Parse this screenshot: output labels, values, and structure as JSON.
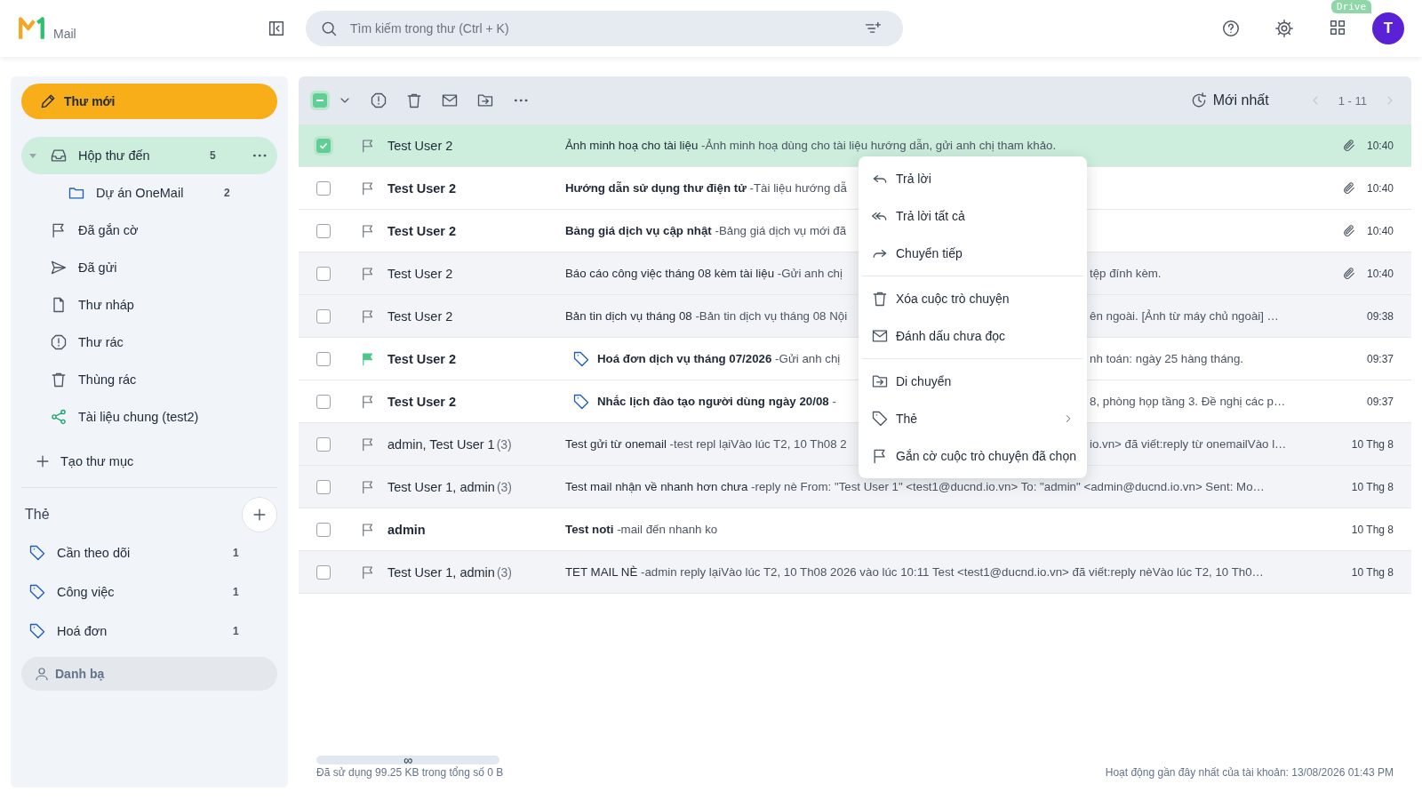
{
  "app": {
    "name": "Mail"
  },
  "search": {
    "placeholder": "Tìm kiếm trong thư (Ctrl + K)"
  },
  "apps_badge": "Drive",
  "avatar": "T",
  "compose": "Thư mới",
  "folders": [
    {
      "name": "Hộp thư đến",
      "count": "5",
      "selected": true,
      "expanded": true,
      "children": [
        {
          "name": "Dự án OneMail",
          "count": "2",
          "selected": false
        }
      ]
    },
    {
      "name": "Đã gắn cờ",
      "selected": false
    },
    {
      "name": "Đã gửi",
      "selected": false
    },
    {
      "name": "Thư nháp",
      "selected": false
    },
    {
      "name": "Thư rác",
      "selected": false
    },
    {
      "name": "Thùng rác",
      "selected": false
    },
    {
      "name": "Tài liệu chung (test2)",
      "selected": false
    }
  ],
  "new_folder": "Tạo thư mục",
  "tags_section": {
    "title": "Thẻ",
    "tags": [
      {
        "name": "Cần theo dõi",
        "count": "1"
      },
      {
        "name": "Công việc",
        "count": "1"
      },
      {
        "name": "Hoá đơn",
        "count": "1"
      }
    ]
  },
  "contacts": "Danh bạ",
  "toolbar": {
    "partial_selection": true,
    "sort": "Mới nhất",
    "range": "1 - 11",
    "prev_disabled": true,
    "next_disabled": true
  },
  "rows": [
    {
      "sender": "Test User 2",
      "subject": "Ảnh minh hoạ cho tài liệu",
      "preview": "-Ảnh minh hoạ dùng cho tài liệu hướng dẫn, gửi anh chị tham khảo.",
      "time": "10:40",
      "unread": false,
      "selected": true,
      "flagged": false,
      "tagged": false,
      "attachment": true
    },
    {
      "sender": "Test User 2",
      "subject": "Hướng dẫn sử dụng thư điện tử",
      "preview": "-Tài liệu hướng dẫ",
      "time": "10:40",
      "unread": true,
      "selected": false,
      "flagged": false,
      "tagged": false,
      "attachment": true
    },
    {
      "sender": "Test User 2",
      "subject": "Bảng giá dịch vụ cập nhật",
      "preview": "-Bảng giá dịch vụ mới đã",
      "time": "10:40",
      "unread": true,
      "selected": false,
      "flagged": false,
      "tagged": false,
      "attachment": true
    },
    {
      "sender": "Test User 2",
      "subject": "Báo cáo công việc tháng 08 kèm tài liệu",
      "preview": "-Gửi anh chị",
      "tail": "tệp đính kèm.",
      "time": "10:40",
      "unread": false,
      "selected": false,
      "flagged": false,
      "tagged": false,
      "attachment": true
    },
    {
      "sender": "Test User 2",
      "subject": "Bản tin dịch vụ tháng 08",
      "preview": "-Bản tin dịch vụ tháng 08 Nội",
      "tail": "ên ngoài. [Ảnh từ máy chủ ngoài] …",
      "time": "09:38",
      "unread": false,
      "selected": false,
      "flagged": false,
      "tagged": false,
      "attachment": false
    },
    {
      "sender": "Test User 2",
      "subject": "Hoá đơn dịch vụ tháng 07/2026",
      "preview": "-Gửi anh chị",
      "tail": "nh toán: ngày 25 hàng tháng.",
      "time": "09:37",
      "unread": true,
      "selected": false,
      "flagged": true,
      "tagged": true,
      "attachment": false
    },
    {
      "sender": "Test User 2",
      "subject": "Nhắc lịch đào tạo người dùng ngày 20/08",
      "preview": "-",
      "tail": "8, phòng họp tầng 3. Đề nghị các p…",
      "time": "09:37",
      "unread": true,
      "selected": false,
      "flagged": false,
      "tagged": true,
      "attachment": false
    },
    {
      "sender": "admin, Test User 1",
      "count": "(3)",
      "subject": "Test gửi từ onemail",
      "preview": "-test repl lạiVào lúc T2, 10 Th08 2",
      "tail": "io.vn> đã viết:reply từ onemailVào l…",
      "time": "10 Thg 8",
      "unread": false,
      "selected": false,
      "flagged": false,
      "tagged": false,
      "attachment": false
    },
    {
      "sender": "Test User 1, admin",
      "count": "(3)",
      "subject": "Test mail nhận về nhanh hơn chưa",
      "preview": "-reply nè From: \"Test User 1\" <test1@ducnd.io.vn> To: \"admin\" <admin@ducnd.io.vn> Sent: Mo…",
      "time": "10 Thg 8",
      "unread": false,
      "selected": false,
      "flagged": false,
      "tagged": false,
      "attachment": false
    },
    {
      "sender": "admin",
      "subject": "Test noti",
      "preview": "-mail đến nhanh ko",
      "time": "10 Thg 8",
      "unread": true,
      "selected": false,
      "flagged": false,
      "tagged": false,
      "attachment": false
    },
    {
      "sender": "Test User 1, admin",
      "count": "(3)",
      "subject": "TET MAIL NÈ",
      "preview": "-admin reply lạiVào lúc T2, 10 Th08 2026 vào lúc 10:11 Test <test1@ducnd.io.vn> đã viết:reply nèVào lúc T2, 10 Th0…",
      "time": "10 Thg 8",
      "unread": false,
      "selected": false,
      "flagged": false,
      "tagged": false,
      "attachment": false
    }
  ],
  "context_menu": {
    "groups": [
      [
        {
          "label": "Trả lời"
        },
        {
          "label": "Trả lời tất cả"
        },
        {
          "label": "Chuyển tiếp"
        }
      ],
      [
        {
          "label": "Xóa cuộc trò chuyện"
        },
        {
          "label": "Đánh dấu chưa đọc"
        }
      ],
      [
        {
          "label": "Di chuyển"
        },
        {
          "label": "Thẻ",
          "submenu": true
        },
        {
          "label": "Gắn cờ cuộc trò chuyện đã chọn"
        }
      ]
    ]
  },
  "footer": {
    "storage": {
      "limit": "∞",
      "level": 0,
      "usage": "Đã sử dụng 99.25 KB trong tổng số 0 B"
    },
    "last_activity": "Hoạt động gần đây nhất của tài khoản: 13/08/2026 01:43 PM"
  }
}
